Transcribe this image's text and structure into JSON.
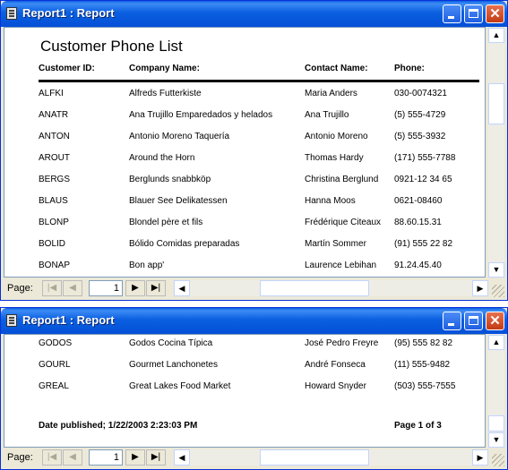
{
  "window1": {
    "title": "Report1 : Report",
    "report_title": "Customer Phone List",
    "headers": [
      "Customer ID:",
      "Company Name:",
      "Contact Name:",
      "Phone:"
    ],
    "rows": [
      [
        "ALFKI",
        "Alfreds Futterkiste",
        "Maria Anders",
        "030-0074321"
      ],
      [
        "ANATR",
        "Ana Trujillo Emparedados y helados",
        "Ana Trujillo",
        "(5) 555-4729"
      ],
      [
        "ANTON",
        "Antonio Moreno Taquería",
        "Antonio Moreno",
        "(5) 555-3932"
      ],
      [
        "AROUT",
        "Around the Horn",
        "Thomas Hardy",
        "(171) 555-7788"
      ],
      [
        "BERGS",
        "Berglunds snabbköp",
        "Christina Berglund",
        "0921-12 34 65"
      ],
      [
        "BLAUS",
        "Blauer See Delikatessen",
        "Hanna Moos",
        "0621-08460"
      ],
      [
        "BLONP",
        "Blondel père et fils",
        "Frédérique Citeaux",
        "88.60.15.31"
      ],
      [
        "BOLID",
        "Bólido Comidas preparadas",
        "Martín Sommer",
        "(91) 555 22 82"
      ],
      [
        "BONAP",
        "Bon app'",
        "Laurence Lebihan",
        "91.24.45.40"
      ]
    ],
    "nav": {
      "page_label": "Page:",
      "page_value": "1"
    }
  },
  "window2": {
    "title": "Report1 : Report",
    "rows": [
      [
        "GODOS",
        "Godos Cocina Típica",
        "José Pedro Freyre",
        "(95) 555 82 82"
      ],
      [
        "GOURL",
        "Gourmet Lanchonetes",
        "André Fonseca",
        "(11) 555-9482"
      ],
      [
        "GREAL",
        "Great Lakes Food Market",
        "Howard Snyder",
        "(503) 555-7555"
      ]
    ],
    "footer_left": "Date published; 1/22/2003 2:23:03 PM",
    "footer_right": "Page 1  of 3",
    "nav": {
      "page_label": "Page:",
      "page_value": "1"
    }
  },
  "icons": [
    "report-icon",
    "minimize-icon",
    "maximize-icon",
    "close-icon",
    "scroll-up-icon",
    "scroll-down-icon",
    "first-page-icon",
    "prev-page-icon",
    "next-page-icon",
    "last-page-icon",
    "scroll-left-icon",
    "scroll-right-icon"
  ]
}
